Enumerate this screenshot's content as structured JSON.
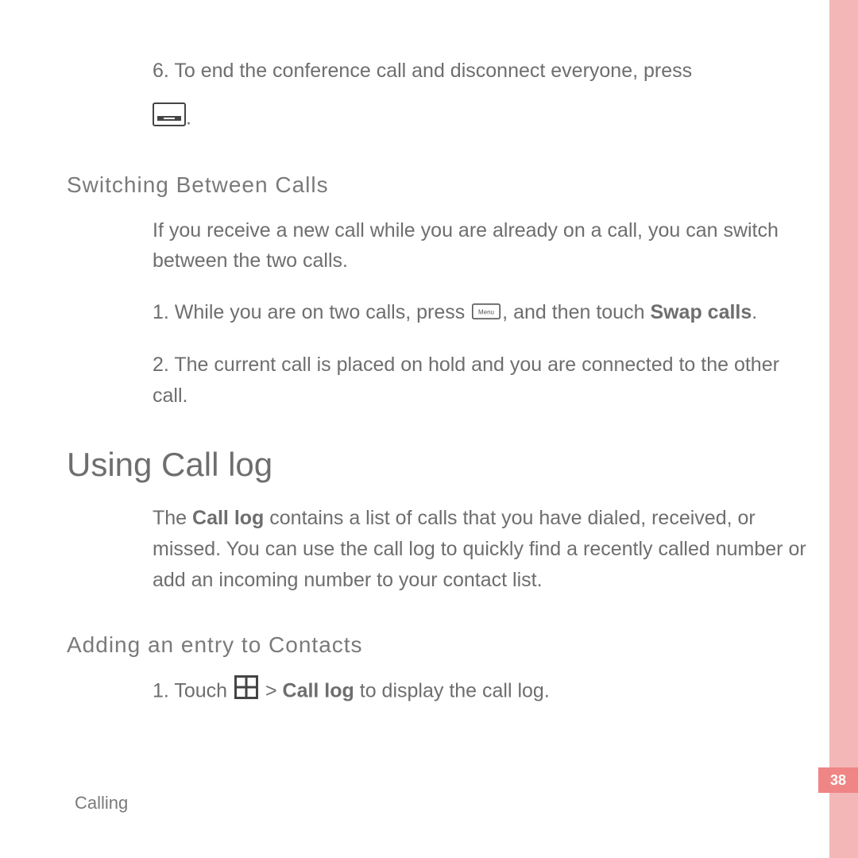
{
  "page": {
    "number": "38",
    "footer_label": "Calling"
  },
  "step6": {
    "prefix": "6. To end the conference call and disconnect everyone, press",
    "period": "."
  },
  "switching": {
    "heading": "Switching Between Calls",
    "intro": "If you receive a new call while you are already on a call, you can switch between the two calls.",
    "step1_a": "1. While you are on two calls, press ",
    "step1_b": ", and then touch ",
    "step1_bold": "Swap calls",
    "step1_c": ".",
    "step2": "2. The current call is placed on hold and you are connected to the other call."
  },
  "calllog": {
    "heading": "Using Call log",
    "intro_a": "The ",
    "intro_bold": "Call log",
    "intro_b": " contains a list of calls that you have dialed, received, or missed. You can use the call log to quickly find a recently called number or add an incoming number to your contact list."
  },
  "adding": {
    "heading": "Adding an entry to Contacts",
    "step1_a": "1. Touch ",
    "step1_b": " > ",
    "step1_bold": "Call log",
    "step1_c": " to display the call log."
  },
  "icons": {
    "hangup": "end-call-key-icon",
    "menu": "menu-key-icon",
    "grid": "apps-grid-icon"
  }
}
